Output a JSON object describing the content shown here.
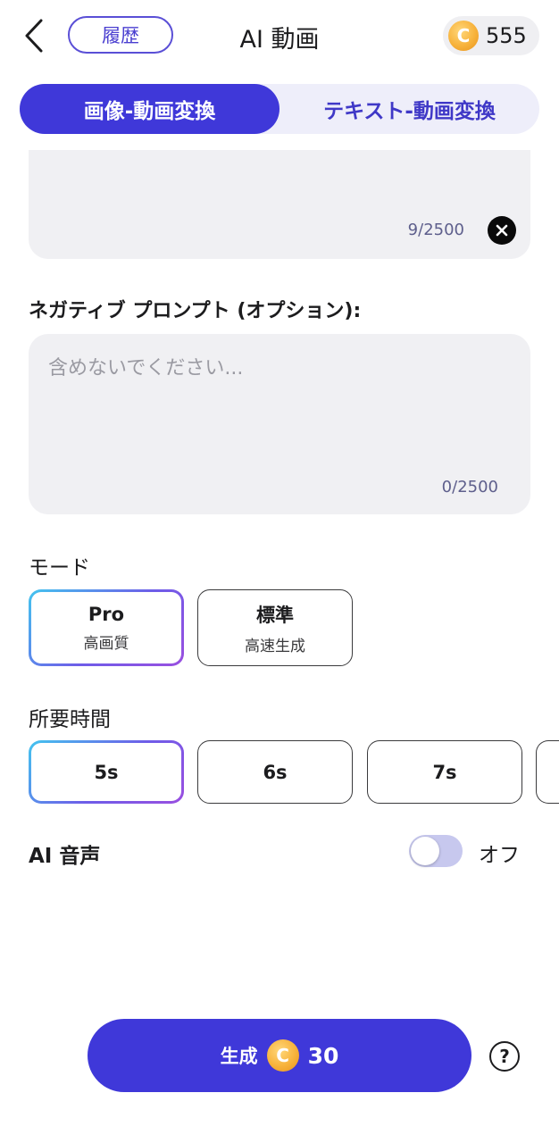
{
  "header": {
    "history_label": "履歴",
    "title": "AI 動画",
    "credits": "555",
    "coin_symbol": "C"
  },
  "tabs": [
    {
      "label": "画像-動画変換",
      "active": true
    },
    {
      "label": "テキスト-動画変換",
      "active": false
    }
  ],
  "prompt": {
    "count": "9/2500"
  },
  "negative_prompt": {
    "label": "ネガティブ プロンプト (オプション):",
    "placeholder": "含めないでください...",
    "value": "",
    "count": "0/2500"
  },
  "mode": {
    "label": "モード",
    "options": [
      {
        "title": "Pro",
        "subtitle": "高画質",
        "selected": true
      },
      {
        "title": "標準",
        "subtitle": "高速生成",
        "selected": false
      }
    ]
  },
  "duration": {
    "label": "所要時間",
    "options": [
      {
        "label": "5s",
        "selected": true
      },
      {
        "label": "6s",
        "selected": false
      },
      {
        "label": "7s",
        "selected": false
      }
    ]
  },
  "ai_voice": {
    "label": "AI 音声",
    "state": "オフ",
    "on": false
  },
  "generate": {
    "label": "生成",
    "coin_symbol": "C",
    "cost": "30"
  },
  "help": {
    "symbol": "?"
  },
  "colors": {
    "accent": "#3f38d9",
    "field_bg": "#f0f0f3",
    "coin": "#f7b23b",
    "toggle_off": "#c7c8ee"
  },
  "icons": {
    "back": "chevron-left-icon",
    "clear": "close-circle-icon",
    "coin": "coin-icon",
    "help": "question-circle-icon"
  }
}
